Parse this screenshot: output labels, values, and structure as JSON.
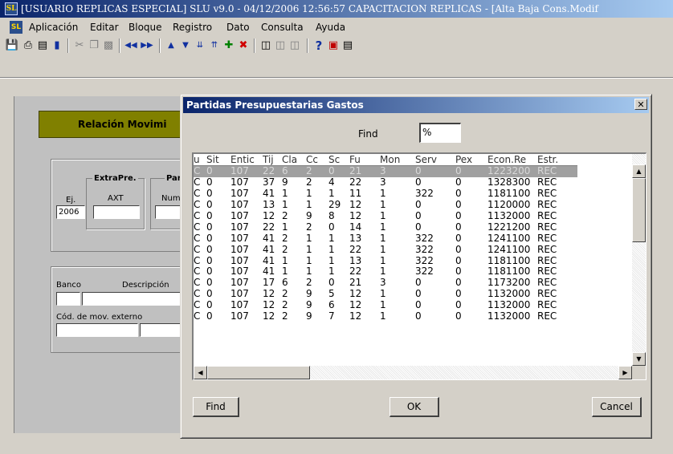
{
  "window": {
    "title": "[USUARIO REPLICAS ESPECIAL] SLU v9.0 - 04/12/2006 12:56:57 CAPACITACION REPLICAS - [Alta Baja Cons.Modif",
    "icon": "app-logo-icon"
  },
  "menu": {
    "items": [
      "Aplicación",
      "Editar",
      "Bloque",
      "Registro",
      "Dato",
      "Consulta",
      "Ayuda"
    ]
  },
  "toolbar": {
    "icons": [
      "save-icon",
      "print-icon",
      "print-setup-icon",
      "exit-icon",
      "cut-icon",
      "copy-icon",
      "paste-icon",
      "previous-block-icon",
      "next-block-icon",
      "previous-record-icon",
      "next-record-icon",
      "scroll-down-icon",
      "scroll-up-icon",
      "insert-record-icon",
      "delete-record-icon",
      "enter-query-icon",
      "execute-query-icon",
      "cancel-query-icon",
      "help-icon",
      "list-values-icon",
      "edit-icon"
    ]
  },
  "background_form": {
    "section_title": "Relación Movimi",
    "extrapre_label": "ExtraPre.",
    "par_label": "Par",
    "ej_label": "Ej.",
    "ej_value": "2006",
    "axt_label": "AXT",
    "num_label": "Num",
    "banco_label": "Banco",
    "descripcion_label": "Descripción",
    "cod_mov_label": "Cód. de mov. externo"
  },
  "dialog": {
    "title": "Partidas Presupuestarias Gastos",
    "find_label": "Find",
    "find_value": "%",
    "columns": [
      "u",
      "Sit",
      "Entic",
      "Tij",
      "Cla",
      "Cc",
      "Sc",
      "Fu",
      "Mon",
      "Serv",
      "Pex",
      "Econ.Re",
      "Estr."
    ],
    "rows": [
      [
        "C",
        "0",
        "107",
        "22",
        "6",
        "2",
        "0",
        "21",
        "3",
        "0",
        "0",
        "1223200",
        "REC"
      ],
      [
        "C",
        "0",
        "107",
        "37",
        "9",
        "2",
        "4",
        "22",
        "3",
        "0",
        "0",
        "1328300",
        "REC"
      ],
      [
        "C",
        "0",
        "107",
        "41",
        "1",
        "1",
        "1",
        "11",
        "1",
        "322",
        "0",
        "1181100",
        "REC"
      ],
      [
        "C",
        "0",
        "107",
        "13",
        "1",
        "1",
        "29",
        "12",
        "1",
        "0",
        "0",
        "1120000",
        "REC"
      ],
      [
        "C",
        "0",
        "107",
        "12",
        "2",
        "9",
        "8",
        "12",
        "1",
        "0",
        "0",
        "1132000",
        "REC"
      ],
      [
        "C",
        "0",
        "107",
        "22",
        "1",
        "2",
        "0",
        "14",
        "1",
        "0",
        "0",
        "1221200",
        "REC"
      ],
      [
        "C",
        "0",
        "107",
        "41",
        "2",
        "1",
        "1",
        "13",
        "1",
        "322",
        "0",
        "1241100",
        "REC"
      ],
      [
        "C",
        "0",
        "107",
        "41",
        "2",
        "1",
        "1",
        "22",
        "1",
        "322",
        "0",
        "1241100",
        "REC"
      ],
      [
        "C",
        "0",
        "107",
        "41",
        "1",
        "1",
        "1",
        "13",
        "1",
        "322",
        "0",
        "1181100",
        "REC"
      ],
      [
        "C",
        "0",
        "107",
        "41",
        "1",
        "1",
        "1",
        "22",
        "1",
        "322",
        "0",
        "1181100",
        "REC"
      ],
      [
        "C",
        "0",
        "107",
        "17",
        "6",
        "2",
        "0",
        "21",
        "3",
        "0",
        "0",
        "1173200",
        "REC"
      ],
      [
        "C",
        "0",
        "107",
        "12",
        "2",
        "9",
        "5",
        "12",
        "1",
        "0",
        "0",
        "1132000",
        "REC"
      ],
      [
        "C",
        "0",
        "107",
        "12",
        "2",
        "9",
        "6",
        "12",
        "1",
        "0",
        "0",
        "1132000",
        "REC"
      ],
      [
        "C",
        "0",
        "107",
        "12",
        "2",
        "9",
        "7",
        "12",
        "1",
        "0",
        "0",
        "1132000",
        "REC"
      ]
    ],
    "buttons": {
      "find": "Find",
      "ok": "OK",
      "cancel": "Cancel"
    }
  }
}
